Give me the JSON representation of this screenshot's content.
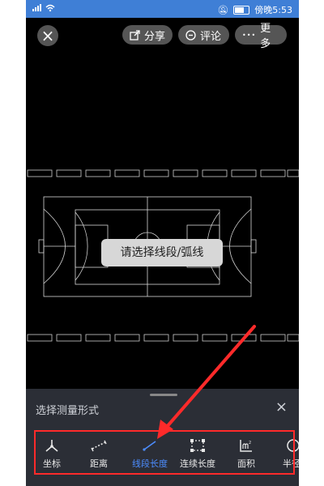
{
  "status": {
    "signal": "…‧‖",
    "time": "傍晚5:53"
  },
  "topbar": {
    "close_glyph": "×",
    "share_label": "分享",
    "comment_label": "评论",
    "more_label": "更多",
    "more_glyph": "•••"
  },
  "toast": "请选择线段/弧线",
  "sheet": {
    "title": "选择测量形式",
    "close_glyph": "×",
    "tools": [
      {
        "label": "坐标",
        "icon": "coordinate-icon"
      },
      {
        "label": "距离",
        "icon": "distance-icon"
      },
      {
        "label": "线段长度",
        "icon": "segment-length-icon",
        "active": true
      },
      {
        "label": "连续长度",
        "icon": "continuous-length-icon"
      },
      {
        "label": "面积",
        "icon": "area-icon"
      },
      {
        "label": "半径",
        "icon": "radius-icon"
      }
    ]
  },
  "colors": {
    "status_bar": "#3f7fd6",
    "canvas": "#000000",
    "sheet": "#2b2e36",
    "accent": "#4c8dff",
    "annotation": "#ff2a2a"
  }
}
